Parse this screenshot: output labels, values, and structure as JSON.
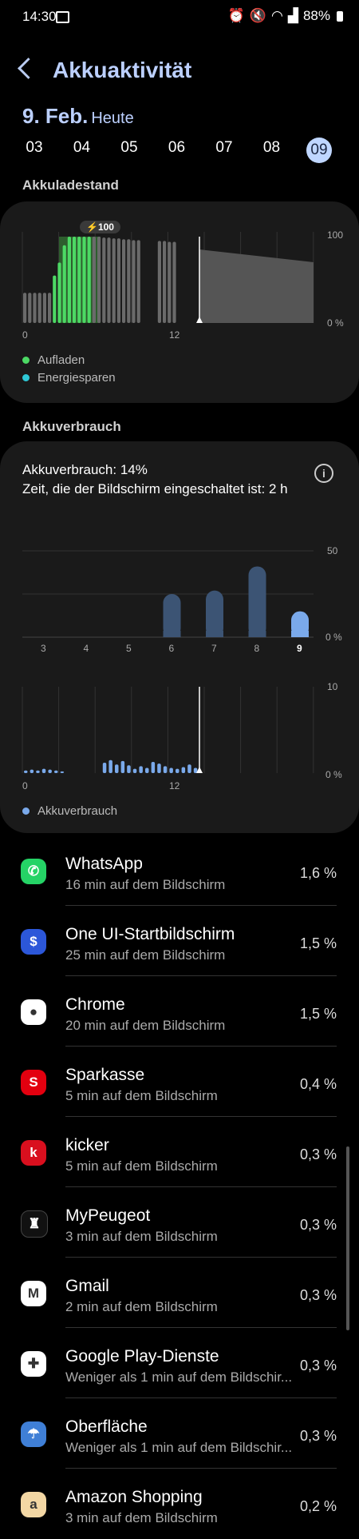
{
  "status_bar": {
    "time": "14:30",
    "battery": "88%"
  },
  "header": {
    "title": "Akkuaktivität"
  },
  "date": {
    "main": "9. Feb.",
    "sub": "Heute"
  },
  "days": [
    "03",
    "04",
    "05",
    "06",
    "07",
    "08",
    "09"
  ],
  "selected_day": "09",
  "akkuladestand": {
    "section_title": "Akkuladestand",
    "badge": "100",
    "y_max": "100",
    "y_min": "0 %",
    "x_ticks": [
      "0",
      "12"
    ],
    "legend": [
      {
        "label": "Aufladen",
        "color": "#4cd964"
      },
      {
        "label": "Energiesparen",
        "color": "#2ec8d6"
      }
    ]
  },
  "akkuverbrauch": {
    "section_title": "Akkuverbrauch",
    "summary": "Akkuverbrauch: 14%",
    "screen_time": "Zeit, die der Bildschirm eingeschaltet ist: 2 h",
    "weekly_chart": {
      "y_max": "50",
      "y_min": "0 %",
      "categories": [
        "3",
        "4",
        "5",
        "6",
        "7",
        "8",
        "9"
      ],
      "values": [
        0,
        0,
        0,
        25,
        27,
        41,
        15
      ]
    },
    "daily_chart": {
      "y_max": "10",
      "y_min": "0 %",
      "x_ticks": [
        "0",
        "12"
      ]
    },
    "legend_label": "Akkuverbrauch",
    "legend_color": "#7aa9ea"
  },
  "apps": [
    {
      "name": "WhatsApp",
      "sub": "16 min auf dem Bildschirm",
      "pct": "1,6 %",
      "icon": "whatsapp-icon",
      "color": "#25d366",
      "glyph": "✆"
    },
    {
      "name": "One UI-Startbildschirm",
      "sub": "25 min auf dem Bildschirm",
      "pct": "1,5 %",
      "icon": "one-ui-home-icon",
      "color": "#2c57d9",
      "glyph": "$"
    },
    {
      "name": "Chrome",
      "sub": "20 min auf dem Bildschirm",
      "pct": "1,5 %",
      "icon": "chrome-icon",
      "color": "#ffffff",
      "glyph": "●"
    },
    {
      "name": "Sparkasse",
      "sub": "5 min auf dem Bildschirm",
      "pct": "0,4 %",
      "icon": "sparkasse-icon",
      "color": "#e3000f",
      "glyph": "S"
    },
    {
      "name": "kicker",
      "sub": "5 min auf dem Bildschirm",
      "pct": "0,3 %",
      "icon": "kicker-icon",
      "color": "#d90f1e",
      "glyph": "k"
    },
    {
      "name": "MyPeugeot",
      "sub": "3 min auf dem Bildschirm",
      "pct": "0,3 %",
      "icon": "mypeugeot-icon",
      "color": "#111111",
      "glyph": "♜"
    },
    {
      "name": "Gmail",
      "sub": "2 min auf dem Bildschirm",
      "pct": "0,3 %",
      "icon": "gmail-icon",
      "color": "#ffffff",
      "glyph": "M"
    },
    {
      "name": "Google Play-Dienste",
      "sub": "Weniger als 1 min auf dem Bildschir...",
      "pct": "0,3 %",
      "icon": "google-play-services-icon",
      "color": "#ffffff",
      "glyph": "✚"
    },
    {
      "name": "Oberfläche",
      "sub": "Weniger als 1 min auf dem Bildschir...",
      "pct": "0,3 %",
      "icon": "system-ui-icon",
      "color": "#3f7fd6",
      "glyph": "☂"
    },
    {
      "name": "Amazon Shopping",
      "sub": "3 min auf dem Bildschirm",
      "pct": "0,2 %",
      "icon": "amazon-shopping-icon",
      "color": "#f3d7a4",
      "glyph": "a"
    }
  ]
}
